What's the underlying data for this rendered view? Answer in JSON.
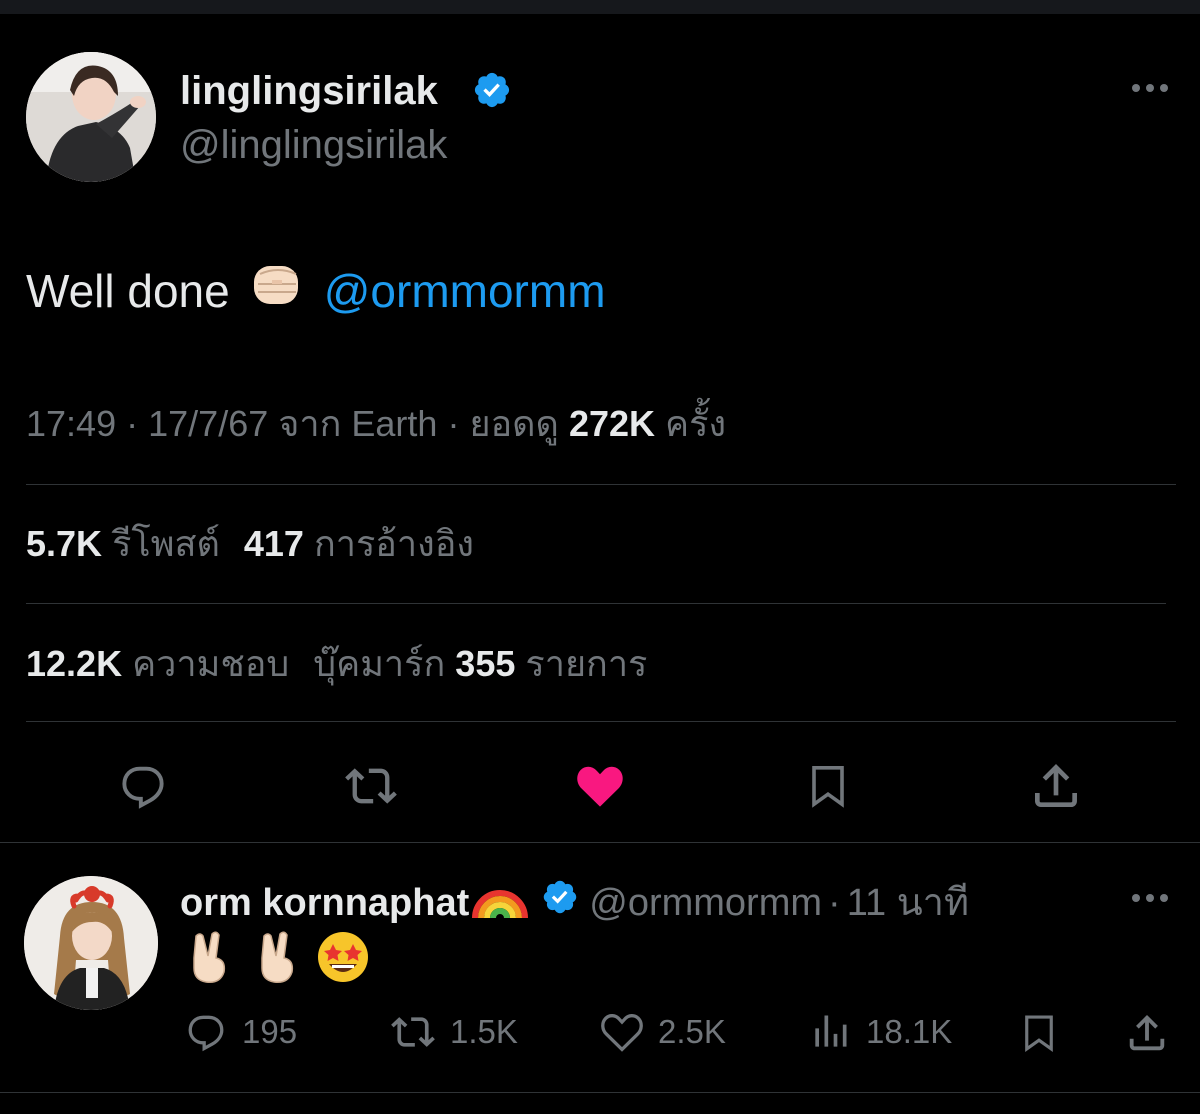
{
  "tweet": {
    "author": {
      "display_name": "linglingsirilak",
      "handle": "@linglingsirilak",
      "verified": true
    },
    "text_plain": "Well done",
    "text_emoji": "fist-bump",
    "mention": "@ormmormm",
    "meta": {
      "time": "17:49",
      "sep1": "·",
      "date": "17/7/67",
      "from_label": "จาก Earth",
      "sep2": "·",
      "views_label": "ยอดดู",
      "views": "272K",
      "views_suffix": "ครั้ง"
    },
    "stats1": [
      {
        "value": "5.7K",
        "label": "รีโพสต์"
      },
      {
        "value": "417",
        "label": "การอ้างอิง"
      }
    ],
    "stats2": {
      "likes_value": "12.2K",
      "likes_label": "ความชอบ",
      "bookmarks_prefix": "บุ๊คมาร์ก",
      "bookmarks_value": "355",
      "bookmarks_suffix": "รายการ"
    },
    "actions": [
      "reply-icon",
      "retweet-icon",
      "heart-filled-icon",
      "bookmark-icon",
      "share-icon"
    ],
    "colors": {
      "like": "#f91880",
      "link": "#1d9bf0",
      "verified": "#1d9bf0"
    }
  },
  "reply": {
    "author": {
      "display_name": "orm kornnaphat",
      "name_emoji": "rainbow",
      "verified": true,
      "handle": "@ormmormm",
      "sep": "·",
      "time": "11 นาที"
    },
    "content_emojis": [
      "victory-hand",
      "victory-hand",
      "star-struck-face"
    ],
    "stats": {
      "replies": "195",
      "reposts": "1.5K",
      "likes": "2.5K",
      "views": "18.1K"
    }
  }
}
